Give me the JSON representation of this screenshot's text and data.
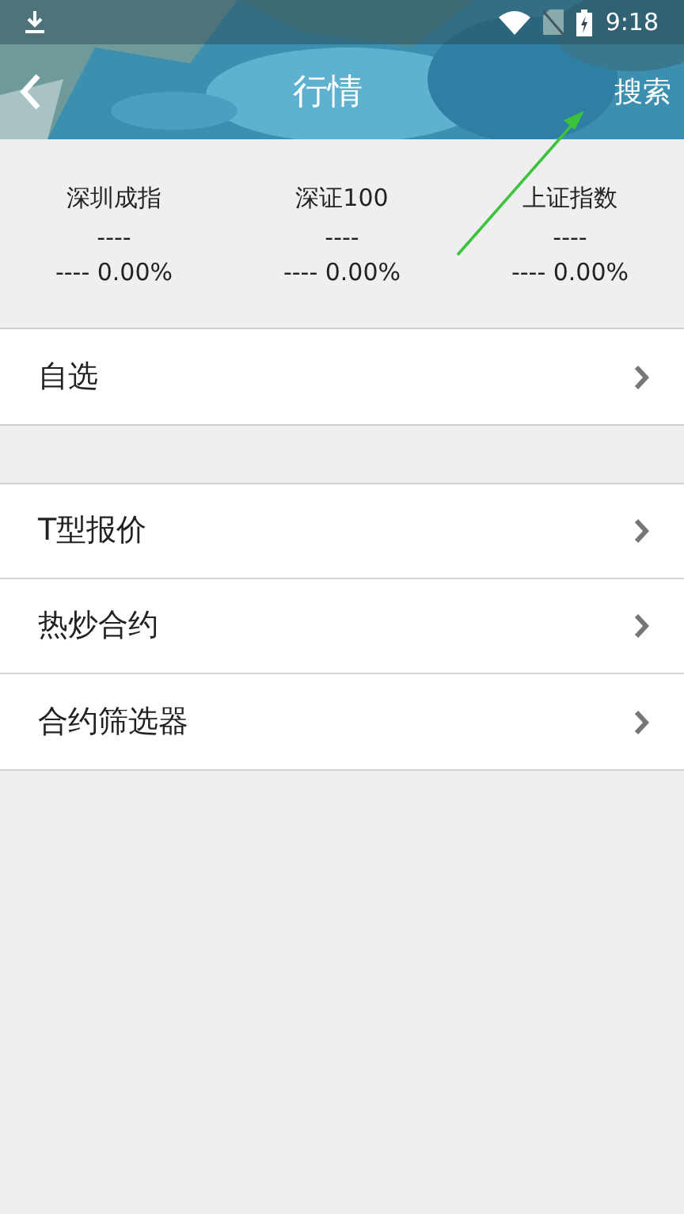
{
  "status_bar": {
    "time": "9:18"
  },
  "header": {
    "title": "行情",
    "action": "搜索"
  },
  "indices": [
    {
      "name": "深圳成指",
      "price": "----",
      "change": "---- 0.00%"
    },
    {
      "name": "深证100",
      "price": "----",
      "change": "---- 0.00%"
    },
    {
      "name": "上证指数",
      "price": "----",
      "change": "---- 0.00%"
    }
  ],
  "menu_groups": [
    [
      {
        "label": "自选"
      }
    ],
    [
      {
        "label": "T型报价"
      },
      {
        "label": "热炒合约"
      },
      {
        "label": "合约筛选器"
      }
    ]
  ],
  "annotation": {
    "kind": "arrow"
  }
}
